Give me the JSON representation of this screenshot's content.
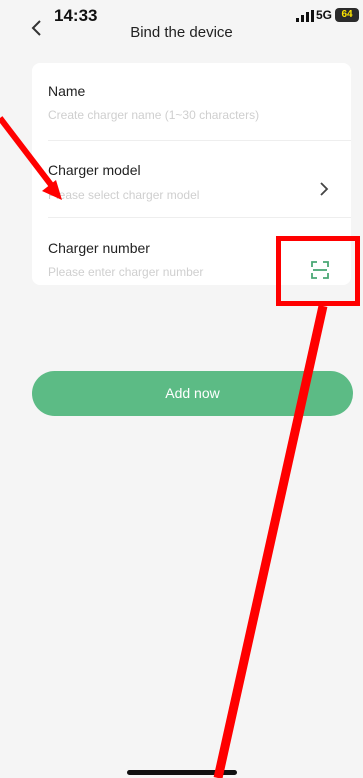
{
  "status": {
    "time": "14:33",
    "network": "5G",
    "battery": "64"
  },
  "header": {
    "title": "Bind the device"
  },
  "form": {
    "name": {
      "label": "Name",
      "placeholder": "Create charger name (1~30 characters)"
    },
    "model": {
      "label": "Charger model",
      "placeholder": "Please select charger model"
    },
    "number": {
      "label": "Charger number",
      "placeholder": "Please enter charger number"
    }
  },
  "actions": {
    "add_label": "Add now"
  },
  "icons": [
    "back-arrow-icon",
    "signal-icon",
    "battery-icon",
    "chevron-right-icon",
    "scan-icon"
  ],
  "colors": {
    "accent": "#5cbb85",
    "annotation": "#ff0000",
    "background": "#f5f5f5"
  }
}
